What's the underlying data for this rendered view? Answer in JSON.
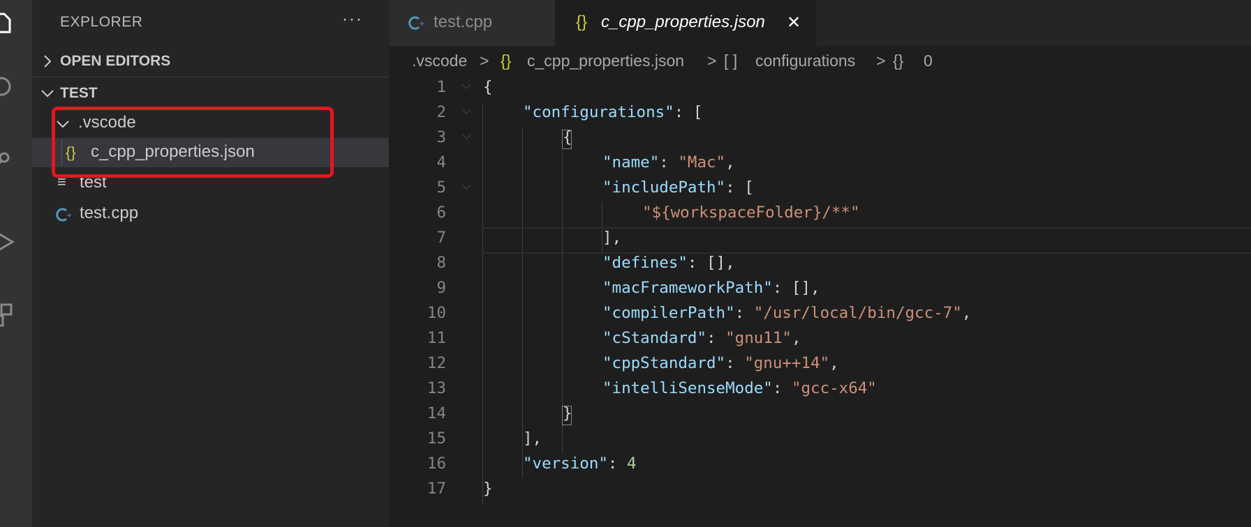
{
  "sidebar": {
    "title": "EXPLORER",
    "more_label": "···",
    "open_editors_label": "OPEN EDITORS",
    "workspace_label": "TEST",
    "tree": [
      {
        "label": ".vscode"
      },
      {
        "label": "c_cpp_properties.json",
        "icon": "{}"
      },
      {
        "label": "test",
        "icon": "≡"
      },
      {
        "label": "test.cpp"
      }
    ]
  },
  "tabs": [
    {
      "label": "test.cpp"
    },
    {
      "label": "c_cpp_properties.json",
      "icon": "{}",
      "close": "✕"
    }
  ],
  "breadcrumb": {
    "folder": ".vscode",
    "file": "c_cpp_properties.json",
    "array_icon": "[ ]",
    "array": "configurations",
    "obj_icon": "{}",
    "obj": "0",
    "sep": ">"
  },
  "editor": {
    "lines": [
      {
        "n": "1",
        "c": "{"
      },
      {
        "n": "2",
        "k": "\"configurations\"",
        "c": ": ["
      },
      {
        "n": "3",
        "c": "{"
      },
      {
        "n": "4",
        "k": "\"name\"",
        "p": ": ",
        "s": "\"Mac\"",
        "t": ","
      },
      {
        "n": "5",
        "k": "\"includePath\"",
        "c": ": ["
      },
      {
        "n": "6",
        "s": "\"${workspaceFolder}/**\""
      },
      {
        "n": "7",
        "c": "],"
      },
      {
        "n": "8",
        "k": "\"defines\"",
        "c": ": [],"
      },
      {
        "n": "9",
        "k": "\"macFrameworkPath\"",
        "c": ": [],"
      },
      {
        "n": "10",
        "k": "\"compilerPath\"",
        "p": ": ",
        "s": "\"/usr/local/bin/gcc-7\"",
        "t": ","
      },
      {
        "n": "11",
        "k": "\"cStandard\"",
        "p": ": ",
        "s": "\"gnu11\"",
        "t": ","
      },
      {
        "n": "12",
        "k": "\"cppStandard\"",
        "p": ": ",
        "s": "\"gnu++14\"",
        "t": ","
      },
      {
        "n": "13",
        "k": "\"intelliSenseMode\"",
        "p": ": ",
        "s": "\"gcc-x64\""
      },
      {
        "n": "14",
        "c": "}"
      },
      {
        "n": "15",
        "c": "],"
      },
      {
        "n": "16",
        "k": "\"version\"",
        "p": ": ",
        "num": "4"
      },
      {
        "n": "17",
        "c": "}"
      }
    ]
  },
  "colors": {
    "key": "#9cdcfe",
    "string": "#ce9178",
    "number": "#b5cea8",
    "json_icon": "#cbcb41",
    "cpp_icon": "#519aba",
    "highlight_box": "#e4161f"
  }
}
